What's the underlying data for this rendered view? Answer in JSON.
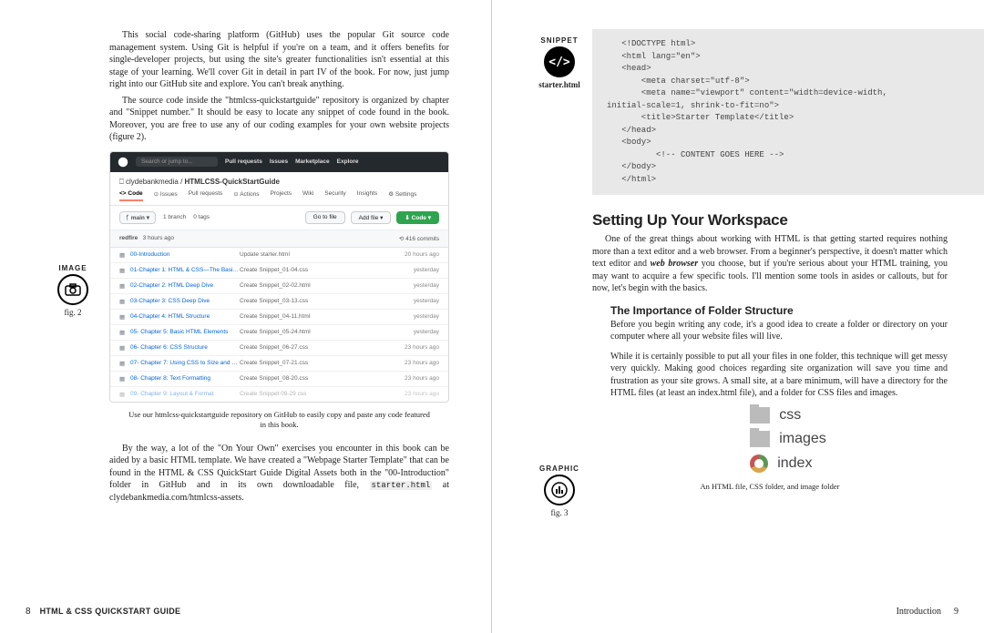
{
  "left": {
    "para1": "This social code-sharing platform (GitHub) uses the popular Git source code management system. Using Git is helpful if you're on a team, and it offers benefits for single-developer projects, but using the site's greater functionalities isn't essential at this stage of your learning. We'll cover Git in detail in part IV of the book. For now, just jump right into our GitHub site and explore. You can't break anything.",
    "para2": "The source code inside the \"htmlcss-quickstartguide\" repository is organized by chapter and \"Snippet number.\" It should be easy to locate any snippet of code found in the book. Moreover, you are free to use any of our coding examples for your own website projects (figure 2).",
    "badge_image": {
      "label": "IMAGE",
      "fig": "fig. 2"
    },
    "github": {
      "search_placeholder": "Search or jump to...",
      "nav": [
        "Pull requests",
        "Issues",
        "Marketplace",
        "Explore"
      ],
      "owner": "clydebankmedia",
      "repo": "HTMLCSS-QuickStartGuide",
      "tabs": [
        "Code",
        "Issues",
        "Pull requests",
        "Actions",
        "Projects",
        "Wiki",
        "Security",
        "Insights",
        "Settings"
      ],
      "branch": "main",
      "branches": "1 branch",
      "tags": "0 tags",
      "btn_gotofile": "Go to file",
      "btn_addfile": "Add file ▾",
      "btn_code": "Code ▾",
      "last_commit_user": "redfire",
      "last_commit_time": "3 hours ago",
      "commits": "416 commits",
      "rows": [
        {
          "name": "00-Introduction",
          "msg": "Update starter.html",
          "time": "20 hours ago"
        },
        {
          "name": "01-Chapter 1: HTML & CSS—The Basi…",
          "msg": "Create Snippet_01-04.css",
          "time": "yesterday"
        },
        {
          "name": "02-Chapter 2: HTML Deep Dive",
          "msg": "Create Snippet_02-02.html",
          "time": "yesterday"
        },
        {
          "name": "03-Chapter 3: CSS Deep Dive",
          "msg": "Create Snippet_03-13.css",
          "time": "yesterday"
        },
        {
          "name": "04-Chapter 4: HTML Structure",
          "msg": "Create Snippet_04-11.html",
          "time": "yesterday"
        },
        {
          "name": "05- Chapter 5: Basic HTML Elements",
          "msg": "Create Snippet_05-24.html",
          "time": "yesterday"
        },
        {
          "name": "06- Chapter 6: CSS Structure",
          "msg": "Create Snippet_06-27.css",
          "time": "23 hours ago"
        },
        {
          "name": "07- Chapter 7: Using CSS to Size and …",
          "msg": "Create Snippet_07-21.css",
          "time": "23 hours ago"
        },
        {
          "name": "08- Chapter 8: Text Formatting",
          "msg": "Create Snippet_08-20.css",
          "time": "23 hours ago"
        },
        {
          "name": "09- Chapter 9: Layout & Format",
          "msg": "Create Snippet 09-29 css",
          "time": "23 hours ago"
        }
      ]
    },
    "caption": "Use our htmlcss-quickstartguide repository on GitHub to easily copy and paste any code featured in this book.",
    "para3a": "By the way, a lot of the \"On Your Own\" exercises you encounter in this book can be aided by a basic HTML template. We have created a \"Webpage Starter Template\" that can be found in the HTML & CSS QuickStart Guide Digital Assets both in the \"00-Introduction\" folder in GitHub and in its own downloadable file, ",
    "para3_code": "starter.html",
    "para3b": " at clydebankmedia.com/htmlcss-assets.",
    "footer": {
      "page": "8",
      "title": "HTML & CSS QUICKSTART GUIDE"
    }
  },
  "right": {
    "badge_snippet": {
      "label": "SNIPPET",
      "fig": "starter.html"
    },
    "code_lines": [
      "   <!DOCTYPE html>",
      "   <html lang=\"en\">",
      "   <head>",
      "       <meta charset=\"utf-8\">",
      "       <meta name=\"viewport\" content=\"width=device-width,",
      "initial-scale=1, shrink-to-fit=no\">",
      "       <title>Starter Template</title>",
      "   </head>",
      "   <body>",
      "          <!-- CONTENT GOES HERE -->",
      "   </body>",
      "   </html>"
    ],
    "h2": "Setting Up Your Workspace",
    "para1a": "One of the great things about working with HTML is that getting started requires nothing more than a text editor and a web browser. From a beginner's perspective, it doesn't matter which text editor and ",
    "para1_em": "web browser",
    "para1b": " you choose, but if you're serious about your HTML training, you may want to acquire a few specific tools. I'll mention some tools in asides or callouts, but for now, let's begin with the basics.",
    "h3": "The Importance of Folder Structure",
    "sub1": "Before you begin writing any code, it's a good idea to create a folder or directory on your computer where all your website files will live.",
    "sub2": "While it is certainly possible to put all your files in one folder, this technique will get messy very quickly. Making good choices regarding site organization will save you time and frustration as your site grows. A small site, at a bare minimum, will have a directory for the HTML files (at least an index.html file), and a folder for CSS files and images.",
    "badge_graphic": {
      "label": "GRAPHIC",
      "fig": "fig. 3"
    },
    "folders": {
      "css": "css",
      "images": "images",
      "index": "index"
    },
    "folder_caption": "An HTML file, CSS folder, and image folder",
    "footer": {
      "section": "Introduction",
      "page": "9"
    }
  }
}
